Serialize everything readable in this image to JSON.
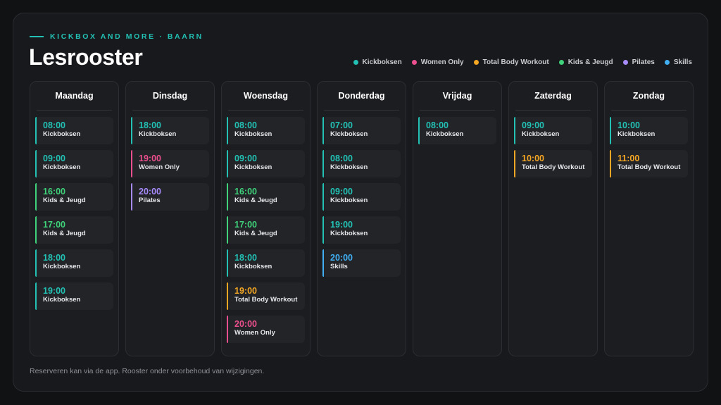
{
  "header": {
    "eyebrow": "KICKBOX AND MORE · BAARN",
    "title": "Lesrooster"
  },
  "colors": {
    "kickboksen": "#22c1b4",
    "women_only": "#ec4f8d",
    "total_body_workout": "#f5a623",
    "kids_jeugd": "#3fd27a",
    "pilates": "#a78bfa",
    "skills": "#41aff2"
  },
  "legend": [
    {
      "label": "Kickboksen",
      "color": "#22c1b4"
    },
    {
      "label": "Women Only",
      "color": "#ec4f8d"
    },
    {
      "label": "Total Body Workout",
      "color": "#f5a623"
    },
    {
      "label": "Kids & Jeugd",
      "color": "#3fd27a"
    },
    {
      "label": "Pilates",
      "color": "#a78bfa"
    },
    {
      "label": "Skills",
      "color": "#41aff2"
    }
  ],
  "days": [
    {
      "name": "Maandag",
      "sessions": [
        {
          "time": "08:00",
          "class": "Kickboksen",
          "color": "#22c1b4"
        },
        {
          "time": "09:00",
          "class": "Kickboksen",
          "color": "#22c1b4"
        },
        {
          "time": "16:00",
          "class": "Kids & Jeugd",
          "color": "#3fd27a"
        },
        {
          "time": "17:00",
          "class": "Kids & Jeugd",
          "color": "#3fd27a"
        },
        {
          "time": "18:00",
          "class": "Kickboksen",
          "color": "#22c1b4"
        },
        {
          "time": "19:00",
          "class": "Kickboksen",
          "color": "#22c1b4"
        }
      ]
    },
    {
      "name": "Dinsdag",
      "sessions": [
        {
          "time": "18:00",
          "class": "Kickboksen",
          "color": "#22c1b4"
        },
        {
          "time": "19:00",
          "class": "Women Only",
          "color": "#ec4f8d"
        },
        {
          "time": "20:00",
          "class": "Pilates",
          "color": "#a78bfa"
        }
      ]
    },
    {
      "name": "Woensdag",
      "sessions": [
        {
          "time": "08:00",
          "class": "Kickboksen",
          "color": "#22c1b4"
        },
        {
          "time": "09:00",
          "class": "Kickboksen",
          "color": "#22c1b4"
        },
        {
          "time": "16:00",
          "class": "Kids & Jeugd",
          "color": "#3fd27a"
        },
        {
          "time": "17:00",
          "class": "Kids & Jeugd",
          "color": "#3fd27a"
        },
        {
          "time": "18:00",
          "class": "Kickboksen",
          "color": "#22c1b4"
        },
        {
          "time": "19:00",
          "class": "Total Body Workout",
          "color": "#f5a623"
        },
        {
          "time": "20:00",
          "class": "Women Only",
          "color": "#ec4f8d"
        }
      ]
    },
    {
      "name": "Donderdag",
      "sessions": [
        {
          "time": "07:00",
          "class": "Kickboksen",
          "color": "#22c1b4"
        },
        {
          "time": "08:00",
          "class": "Kickboksen",
          "color": "#22c1b4"
        },
        {
          "time": "09:00",
          "class": "Kickboksen",
          "color": "#22c1b4"
        },
        {
          "time": "19:00",
          "class": "Kickboksen",
          "color": "#22c1b4"
        },
        {
          "time": "20:00",
          "class": "Skills",
          "color": "#41aff2"
        }
      ]
    },
    {
      "name": "Vrijdag",
      "sessions": [
        {
          "time": "08:00",
          "class": "Kickboksen",
          "color": "#22c1b4"
        }
      ]
    },
    {
      "name": "Zaterdag",
      "sessions": [
        {
          "time": "09:00",
          "class": "Kickboksen",
          "color": "#22c1b4"
        },
        {
          "time": "10:00",
          "class": "Total Body Workout",
          "color": "#f5a623"
        }
      ]
    },
    {
      "name": "Zondag",
      "sessions": [
        {
          "time": "10:00",
          "class": "Kickboksen",
          "color": "#22c1b4"
        },
        {
          "time": "11:00",
          "class": "Total Body Workout",
          "color": "#f5a623"
        }
      ]
    }
  ],
  "footer": {
    "note": "Reserveren kan via de app. Rooster onder voorbehoud van wijzigingen."
  }
}
